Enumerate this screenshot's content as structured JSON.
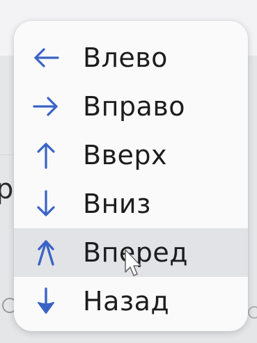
{
  "menu": {
    "items": [
      {
        "label": "Влево",
        "icon": "arrow-left-icon"
      },
      {
        "label": "Вправо",
        "icon": "arrow-right-icon"
      },
      {
        "label": "Вверх",
        "icon": "arrow-up-icon"
      },
      {
        "label": "Вниз",
        "icon": "arrow-down-icon"
      },
      {
        "label": "Вперед",
        "icon": "double-arrow-up-icon",
        "highlighted": true
      },
      {
        "label": "Назад",
        "icon": "arrow-down-bold-icon"
      }
    ]
  },
  "colors": {
    "icon_blue": "#3a63c6",
    "menu_background": "#fafafa",
    "highlight_background": "#e2e3e6",
    "text": "#1d1d1f"
  }
}
